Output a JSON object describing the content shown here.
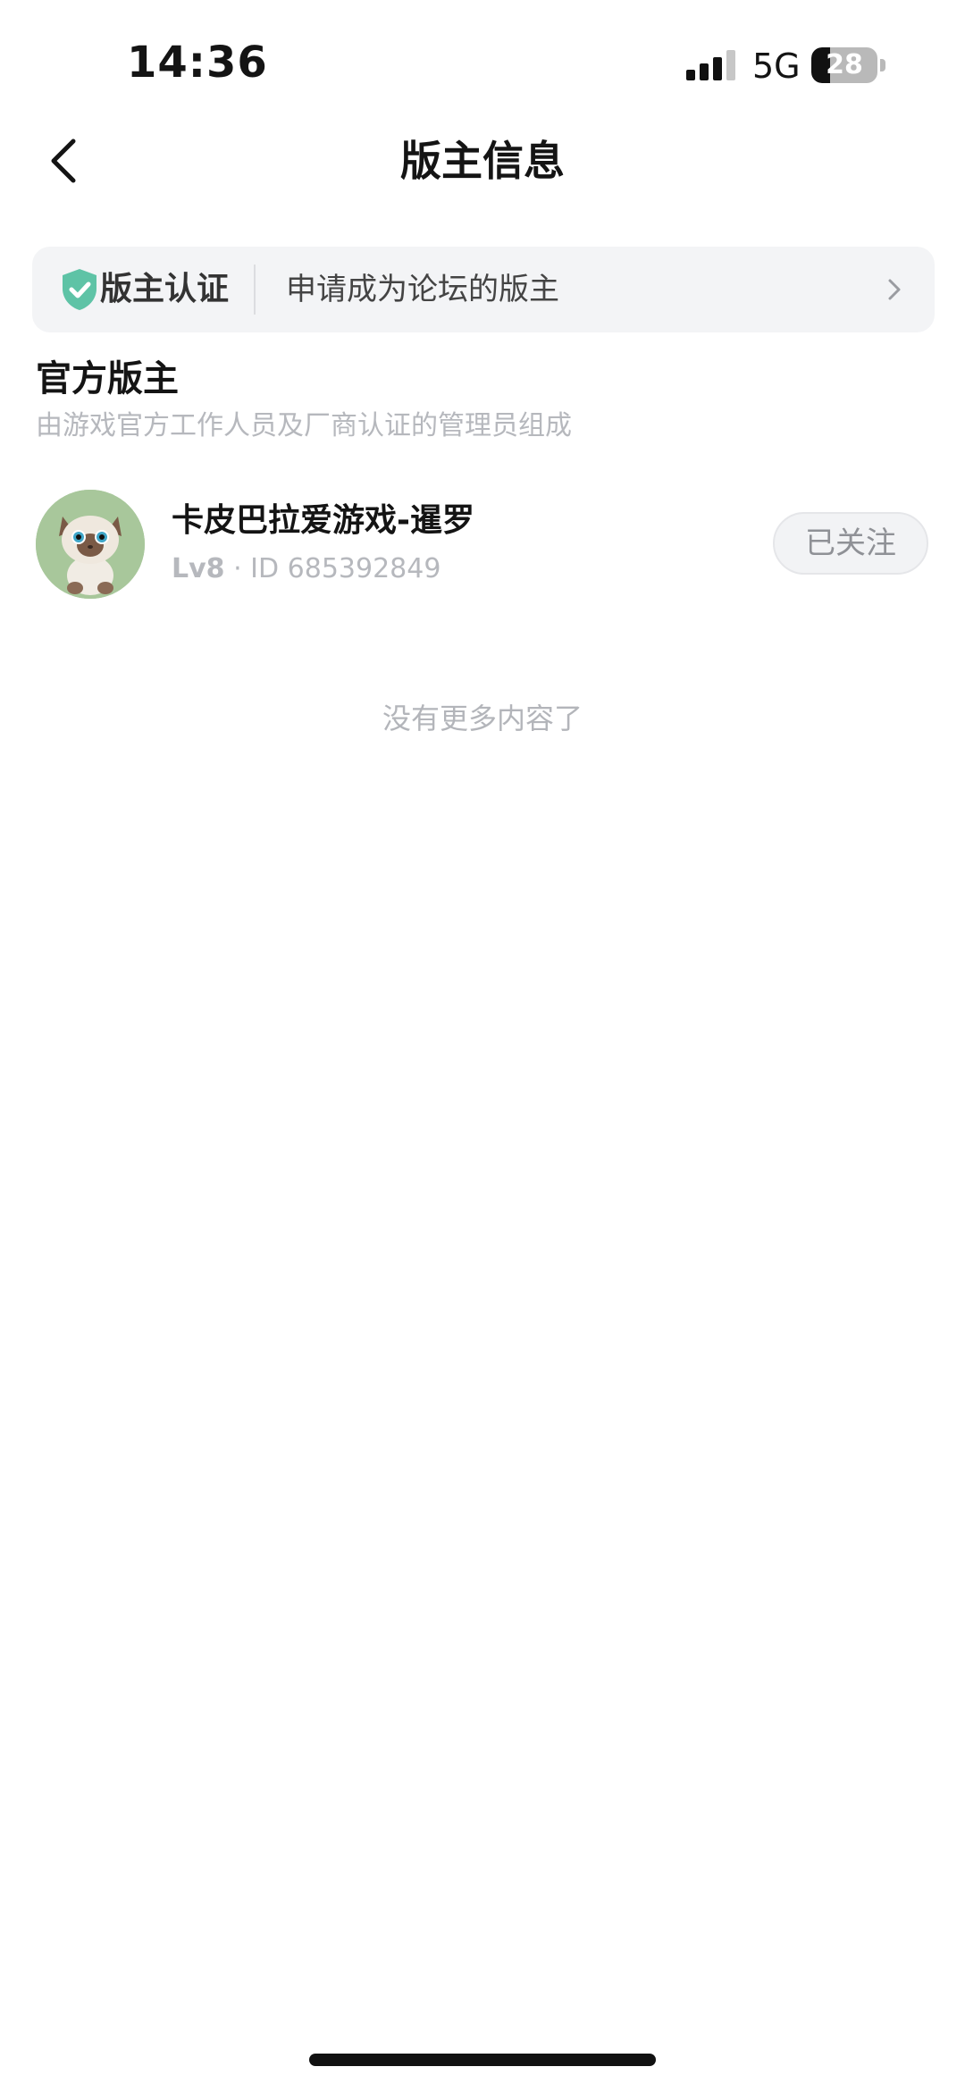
{
  "status_bar": {
    "time": "14:36",
    "network": "5G",
    "battery_level": "28",
    "battery_fraction": 0.28
  },
  "nav": {
    "title": "版主信息",
    "back_icon": "chevron-left-icon"
  },
  "certification": {
    "label": "版主认证",
    "apply_text": "申请成为论坛的版主",
    "icon": "shield-check-icon",
    "accent_color": "#5ec3a6"
  },
  "section": {
    "title": "官方版主",
    "subtitle": "由游戏官方工作人员及厂商认证的管理员组成"
  },
  "moderators": [
    {
      "name": "卡皮巴拉爱游戏-暹罗",
      "level": "Lv8",
      "separator": " · ",
      "id_text": "ID 685392849",
      "follow_label": "已关注",
      "avatar": "siamese-cat-avatar"
    }
  ],
  "list_end_text": "没有更多内容了"
}
